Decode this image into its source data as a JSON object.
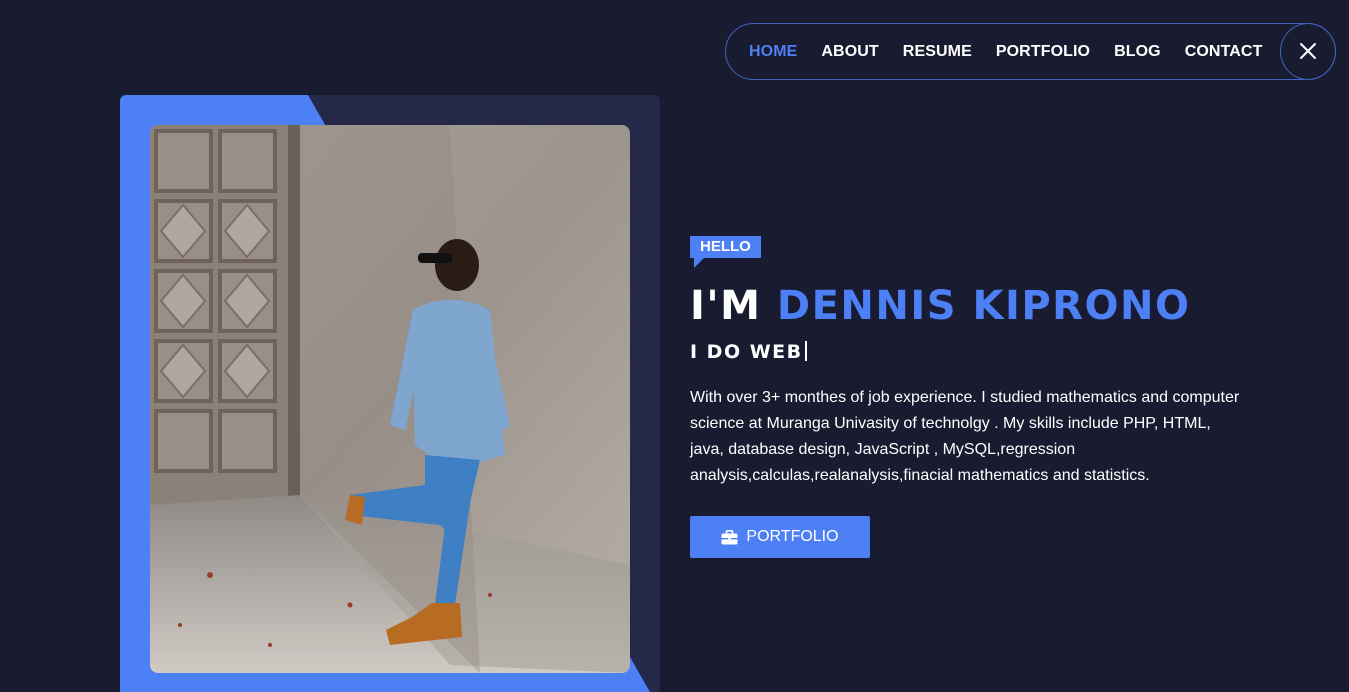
{
  "nav": {
    "items": [
      {
        "label": "HOME",
        "active": true
      },
      {
        "label": "ABOUT",
        "active": false
      },
      {
        "label": "RESUME",
        "active": false
      },
      {
        "label": "PORTFOLIO",
        "active": false
      },
      {
        "label": "BLOG",
        "active": false
      },
      {
        "label": "CONTACT",
        "active": false
      }
    ],
    "close_icon": "close-icon"
  },
  "hero": {
    "badge": "HELLO",
    "greeting": "I'M",
    "name": "DENNIS KIPRONO",
    "tagline": "I DO WEB",
    "bio": "With over 3+ monthes of job experience. I studied mathematics and computer science at Muranga Univasity of technolgy . My skills include PHP, HTML, java, database design, JavaScript , MySQL,regression analysis,calculas,realanalysis,finacial mathematics and statistics.",
    "button_label": "PORTFOLIO",
    "button_icon": "briefcase-icon"
  },
  "colors": {
    "background": "#191c31",
    "card": "#24294a",
    "accent": "#4d7ff5",
    "nav_border": "#3f63bf"
  }
}
